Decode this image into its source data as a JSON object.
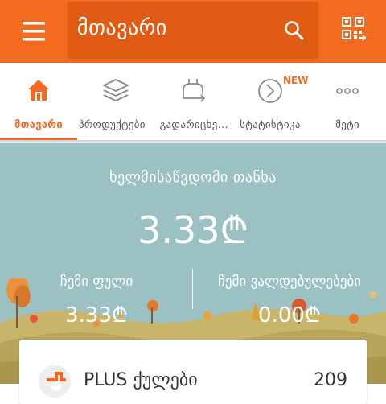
{
  "header": {
    "title": "მთავარი",
    "menu_icon": "menu-icon",
    "search_icon": "search-icon",
    "qr_icon": "qr-scan-icon"
  },
  "tabs": [
    {
      "label": "მთავარი",
      "icon": "home-icon",
      "active": true
    },
    {
      "label": "პროდუქტები",
      "icon": "layers-icon",
      "active": false
    },
    {
      "label": "გადარიცხვ...",
      "icon": "transfer-icon",
      "active": false
    },
    {
      "label": "სტატისტიკა",
      "icon": "statistics-icon",
      "active": false,
      "badge": "NEW"
    },
    {
      "label": "მეტი",
      "icon": "more-icon",
      "active": false
    }
  ],
  "balance": {
    "label": "ხელმისაწვდომი თანხა",
    "amount": "3.33₾"
  },
  "my_money": {
    "label": "ჩემი ფული",
    "amount": "3.33₾"
  },
  "obligations": {
    "label": "ჩემი ვალდებულებები",
    "amount": "0.00₾"
  },
  "plus_card": {
    "title": "PLUS ქულები",
    "value": "209"
  },
  "colors": {
    "brand": "#f46a1f",
    "hero_bg": "#9cc1c2"
  }
}
